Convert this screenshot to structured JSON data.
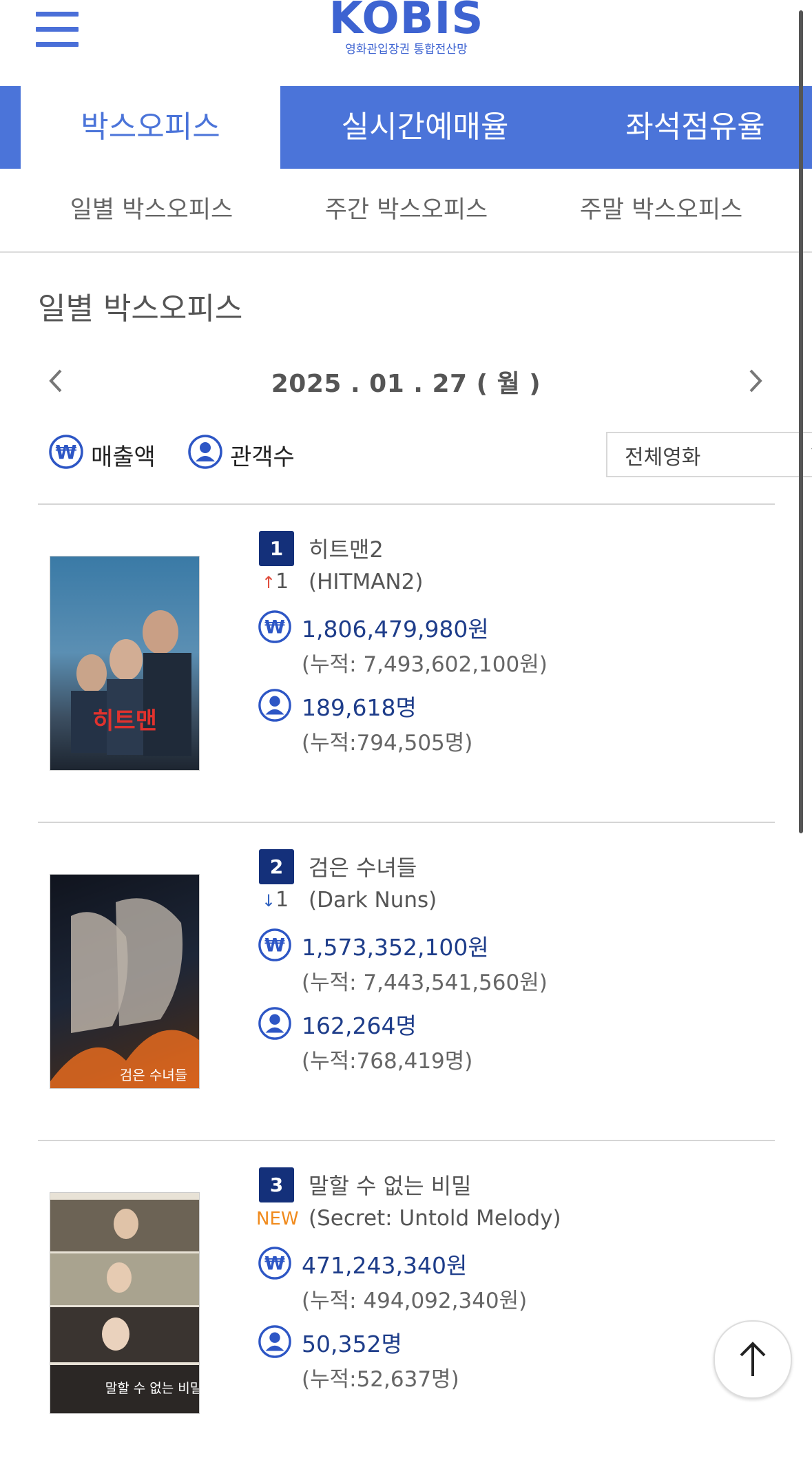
{
  "logo": {
    "main": "KOBIS",
    "sub": "영화관입장권 통합전산망"
  },
  "main_tabs": [
    {
      "label": "박스오피스"
    },
    {
      "label": "실시간예매율"
    },
    {
      "label": "좌석점유율"
    }
  ],
  "sub_tabs": [
    {
      "label": "일별 박스오피스"
    },
    {
      "label": "주간 박스오피스"
    },
    {
      "label": "주말 박스오피스"
    }
  ],
  "section_title": "일별 박스오피스",
  "date": "2025 . 01 . 27 ( 월 )",
  "legend": {
    "revenue": "매출액",
    "audience": "관객수"
  },
  "filter": {
    "selected": "전체영화"
  },
  "colors": {
    "brand": "#4b74d9",
    "rank_badge": "#14307a",
    "rank_up": "#e04a3a",
    "rank_down": "#2d5fbf",
    "new": "#f08a1c"
  },
  "movies": [
    {
      "rank": "1",
      "title_ko": "히트맨2",
      "title_en": "(HITMAN2)",
      "change": "1",
      "change_dir": "up",
      "revenue": "1,806,479,980원",
      "revenue_total": "(누적: 7,493,602,100원)",
      "audience": "189,618명",
      "audience_total": "(누적:794,505명)",
      "poster_text": "히트맨"
    },
    {
      "rank": "2",
      "title_ko": "검은 수녀들",
      "title_en": "(Dark Nuns)",
      "change": "1",
      "change_dir": "down",
      "revenue": "1,573,352,100원",
      "revenue_total": "(누적: 7,443,541,560원)",
      "audience": "162,264명",
      "audience_total": "(누적:768,419명)",
      "poster_text": "검은 수녀들"
    },
    {
      "rank": "3",
      "title_ko": "말할 수 없는 비밀",
      "title_en": "(Secret: Untold Melody)",
      "change": "NEW",
      "change_dir": "new",
      "revenue": "471,243,340원",
      "revenue_total": "(누적: 494,092,340원)",
      "audience": "50,352명",
      "audience_total": "(누적:52,637명)",
      "poster_text": "말할 수 없는 비밀"
    }
  ],
  "icons": {
    "menu": "hamburger-icon",
    "revenue": "won-icon",
    "audience": "person-icon",
    "prev": "chevron-left-icon",
    "next": "chevron-right-icon",
    "top": "arrow-up-icon"
  }
}
